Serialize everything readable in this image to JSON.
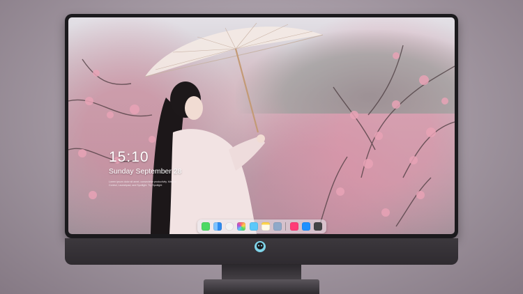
{
  "lock_screen": {
    "time": "15:10",
    "date": "Sunday September 28",
    "notice_line1": "Lorem ipsum dolor sit amet, consectetur productivity. Mission",
    "notice_line2": "Control, Launchpad, and Spotlight. Try Spotlight"
  },
  "dock": {
    "icons": [
      {
        "name": "messages-icon",
        "color": "#4cd964"
      },
      {
        "name": "finder-icon",
        "color": "#2d8cf0"
      },
      {
        "name": "clock-icon",
        "color": "#f2f2f2"
      },
      {
        "name": "photos-icon",
        "color": "#e6d07a"
      },
      {
        "name": "video-icon",
        "color": "#5ac8fa"
      },
      {
        "name": "notes-icon",
        "color": "#ffd54a"
      },
      {
        "name": "preview-icon",
        "color": "#8fa9c9"
      },
      {
        "name": "music-icon",
        "color": "#ff3b77"
      },
      {
        "name": "app-store-icon",
        "color": "#1e90ff"
      },
      {
        "name": "camera-icon",
        "color": "#444446"
      }
    ]
  },
  "monitor": {
    "logo": "alien-logo-icon"
  }
}
